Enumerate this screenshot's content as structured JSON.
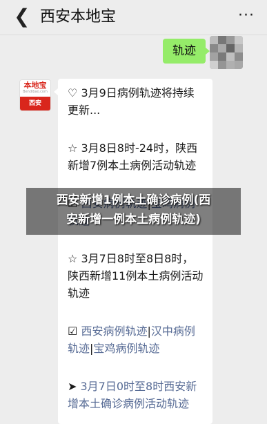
{
  "header": {
    "back_icon": "chevron-left-icon",
    "title": "西安本地宝",
    "more_icon": "ellipsis-icon",
    "more_glyph": "···"
  },
  "sent_message": {
    "text": "轨迹"
  },
  "bot_avatar": {
    "brand": "本地宝",
    "url_text": "Bendibao.com",
    "city": "西安"
  },
  "reply": {
    "items": [
      {
        "prefix": "♡ ",
        "text": "3月9日病例轨迹将持续更新..."
      },
      {
        "prefix": "☆ ",
        "text": "3月8日8时-24时，陕西新增7例本土病例活动轨迹"
      },
      {
        "prefix": "☑ ",
        "link1": "西安病例轨迹",
        "sep": "|",
        "link2": "宝鸡病例轨迹"
      },
      {
        "prefix": "☆ ",
        "text": "3月7日8时至8日8时，陕西新增11例本土病例活动轨迹"
      },
      {
        "prefix": "☑ ",
        "link1": "西安病例轨迹",
        "sep1": "|",
        "link2": "汉中病例轨迹",
        "sep2": "|",
        "link3": "宝鸡病例轨迹"
      },
      {
        "prefix": "➤ ",
        "link1": "3月7日0时至8时西安新增本土确诊病例活动轨迹"
      }
    ]
  },
  "overlay": {
    "line1": "西安新增1例本土确诊病例(西",
    "line2": "安新增一例本土病例轨迹)"
  },
  "colors": {
    "sent_bubble": "#95ec69",
    "link": "#576b95",
    "brand_red": "#d9261c"
  }
}
